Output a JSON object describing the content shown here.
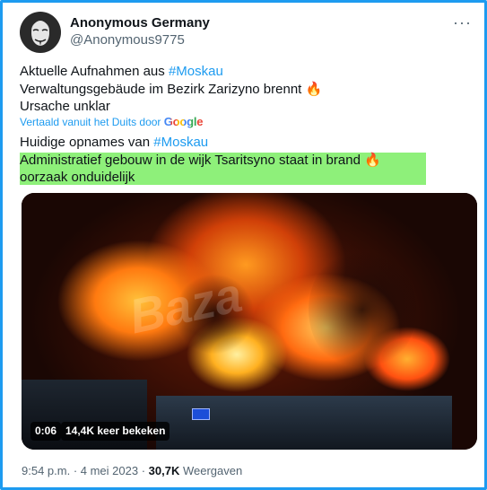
{
  "author": {
    "name": "Anonymous Germany",
    "handle": "@Anonymous9775",
    "avatar_icon": "guy-fawkes-mask-icon"
  },
  "more_icon": "more-horizontal-icon",
  "more_glyph": "···",
  "original": {
    "line1_text": "Aktuelle Aufnahmen aus ",
    "line1_hashtag": "#Moskau",
    "line2_text": "Verwaltungsgebäude im Bezirk Zarizyno brennt ",
    "line2_emoji": "🔥",
    "line3_text": "Ursache unklar"
  },
  "translation_note": {
    "label": "Vertaald vanuit het Duits door ",
    "provider": "Google"
  },
  "translated": {
    "line1_text": "Huidige opnames van ",
    "line1_hashtag": "#Moskau",
    "line2_text": "Administratief gebouw in de wijk Tsaritsyno staat in brand ",
    "line2_emoji": "🔥",
    "line3_text": "oorzaak onduidelijk"
  },
  "video": {
    "duration": "0:06",
    "views_label": "14,4K keer bekeken",
    "watermark": "Baza"
  },
  "footer": {
    "time": "9:54 p.m.",
    "separator": " · ",
    "date": "4 mei 2023",
    "views_count": "30,7K",
    "views_label": " Weergaven"
  },
  "colors": {
    "accent": "#1d9bf0",
    "highlight": "#8ef07a",
    "muted": "#536471",
    "text": "#0f1419"
  }
}
